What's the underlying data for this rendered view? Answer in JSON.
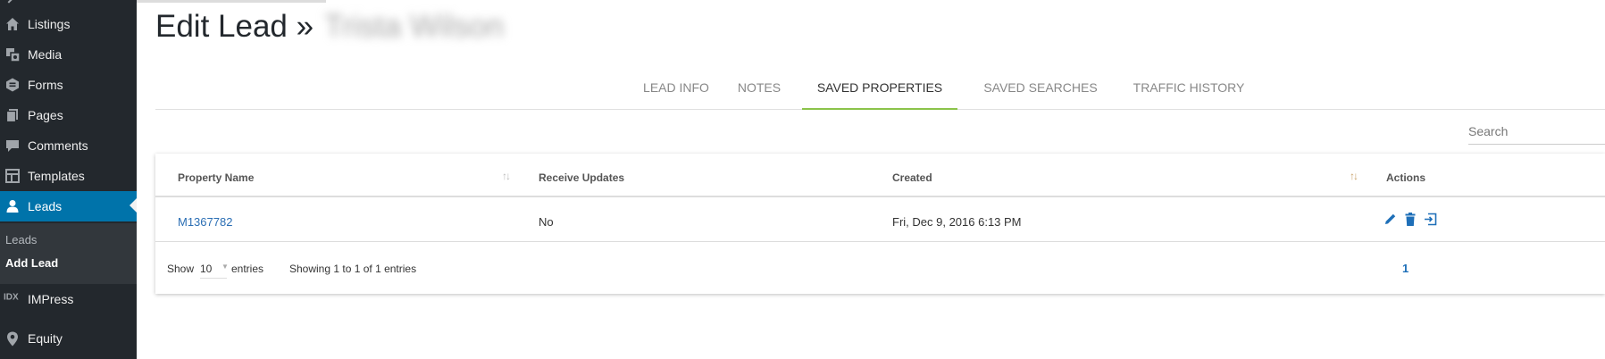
{
  "sidebar": {
    "items": [
      {
        "label": "Listings",
        "icon": "home-icon"
      },
      {
        "label": "Media",
        "icon": "media-icon"
      },
      {
        "label": "Forms",
        "icon": "forms-icon"
      },
      {
        "label": "Pages",
        "icon": "pages-icon"
      },
      {
        "label": "Comments",
        "icon": "comments-icon"
      },
      {
        "label": "Templates",
        "icon": "templates-icon"
      },
      {
        "label": "Leads",
        "icon": "leads-icon"
      },
      {
        "label": "IMPress",
        "icon": "idx-icon"
      },
      {
        "label": "Equity",
        "icon": "location-pin-icon"
      }
    ],
    "submenu": [
      {
        "label": "Leads"
      },
      {
        "label": "Add Lead"
      }
    ],
    "active_color": "#0073aa"
  },
  "header": {
    "title": "Edit Lead »",
    "lead_name": "Trista Wilson"
  },
  "tabs": [
    {
      "label": "LEAD INFO"
    },
    {
      "label": "NOTES"
    },
    {
      "label": "SAVED PROPERTIES"
    },
    {
      "label": "SAVED SEARCHES"
    },
    {
      "label": "TRAFFIC HISTORY"
    }
  ],
  "active_tab": "SAVED PROPERTIES",
  "search": {
    "placeholder": "Search",
    "value": ""
  },
  "table": {
    "columns": [
      "Property Name",
      "Receive Updates",
      "Created",
      "Actions"
    ],
    "rows": [
      {
        "property_name": "M1367782",
        "receive_updates": "No",
        "created": "Fri, Dec 9, 2016 6:13 PM"
      }
    ],
    "row_actions": [
      "edit-icon",
      "trash-icon",
      "open-icon"
    ]
  },
  "footer": {
    "show_label": "Show",
    "page_length": "10",
    "entries_label": "entries",
    "info": "Showing 1 to 1 of 1 entries",
    "current_page": "1"
  },
  "colors": {
    "accent": "#8bc34a",
    "link": "#1e6fb8"
  }
}
